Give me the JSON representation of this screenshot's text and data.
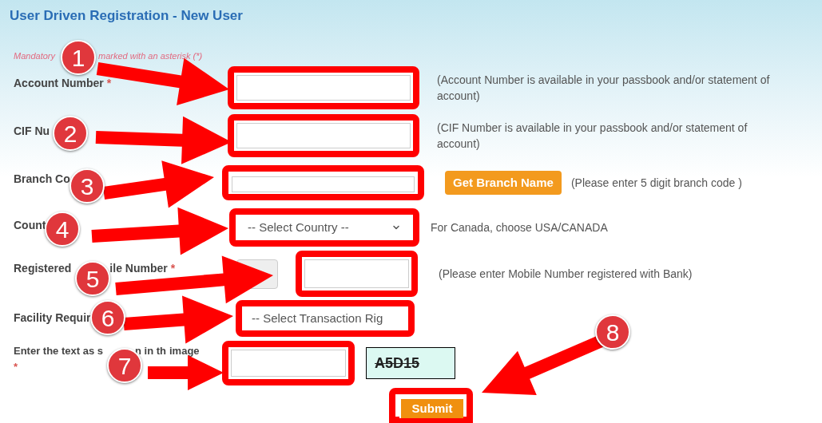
{
  "title": "User Driven Registration - New User",
  "note_parts": [
    "Mandatory",
    "marked with an asterisk (*)"
  ],
  "rows": [
    {
      "kind": "input",
      "label_parts": [
        "Account Number"
      ],
      "asterisk": "*",
      "help": "(Account Number is available in your passbook and/or statement of account)"
    },
    {
      "kind": "input",
      "label_parts": [
        "CIF Nu"
      ],
      "help": "(CIF Number is available in your passbook and/or statement of account)"
    },
    {
      "kind": "branch",
      "label_parts": [
        "Branch Co"
      ],
      "button": "Get Branch Name",
      "help": "(Please enter 5 digit branch code )"
    },
    {
      "kind": "select",
      "label_parts": [
        "Count"
      ],
      "value": "-- Select Country --",
      "help": "For Canada, choose USA/CANADA"
    },
    {
      "kind": "mobile",
      "label_parts": [
        "Registered",
        "ile Number"
      ],
      "asterisk": "*",
      "help": "(Please enter Mobile Number registered with Bank)"
    },
    {
      "kind": "facility",
      "label_parts": [
        "Facility Requir"
      ],
      "value": "-- Select Transaction Rig"
    },
    {
      "kind": "captcha",
      "label_parts": [
        "Enter the text as s",
        "n in th",
        "image"
      ],
      "asterisk": "*",
      "captcha": "A5D15"
    }
  ],
  "submit": "Submit",
  "annotations": [
    "1",
    "2",
    "3",
    "4",
    "5",
    "6",
    "7",
    "8"
  ]
}
